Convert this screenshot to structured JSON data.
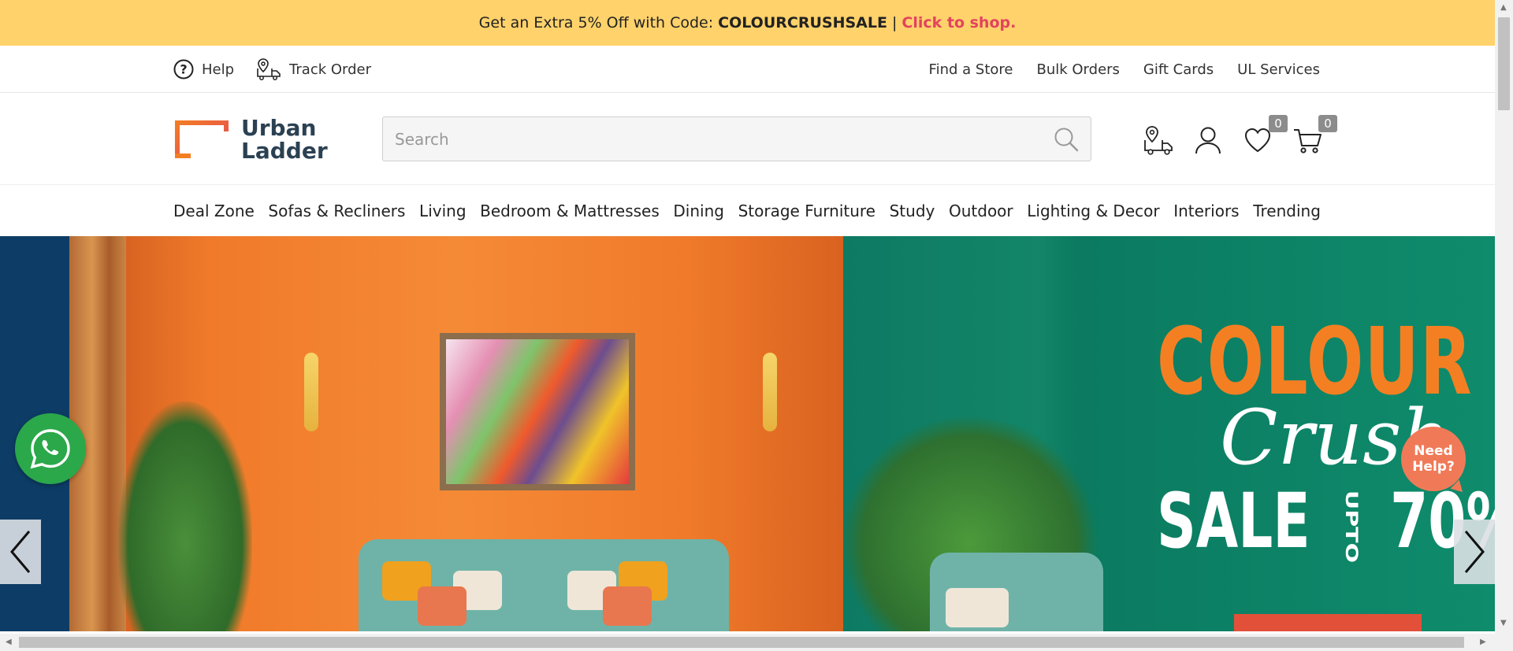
{
  "promo": {
    "text": "Get an Extra 5% Off with Code:",
    "code": "COLOURCRUSHSALE",
    "separator": "|",
    "link": "Click to shop."
  },
  "utility": {
    "help": "Help",
    "track_order": "Track Order",
    "links": [
      "Find a Store",
      "Bulk Orders",
      "Gift Cards",
      "UL Services"
    ]
  },
  "header": {
    "logo_line1": "Urban",
    "logo_line2": "Ladder",
    "search_placeholder": "Search",
    "wishlist_count": "0",
    "cart_count": "0"
  },
  "nav": {
    "items": [
      "Deal Zone",
      "Sofas & Recliners",
      "Living",
      "Bedroom & Mattresses",
      "Dining",
      "Storage Furniture",
      "Study",
      "Outdoor",
      "Lighting & Decor",
      "Interiors",
      "Trending"
    ]
  },
  "hero": {
    "line1": "COLOUR",
    "line2": "Crush",
    "line3": "SALE",
    "upto": "UPTO",
    "percent": "70%"
  },
  "floating": {
    "need_help": "Need Help?"
  },
  "colors": {
    "promo_bg": "#ffd26b",
    "promo_link": "#e2435e",
    "brand_orange": "#f47f22",
    "hero_green": "#0f8c6c",
    "whatsapp": "#2ba84a"
  }
}
